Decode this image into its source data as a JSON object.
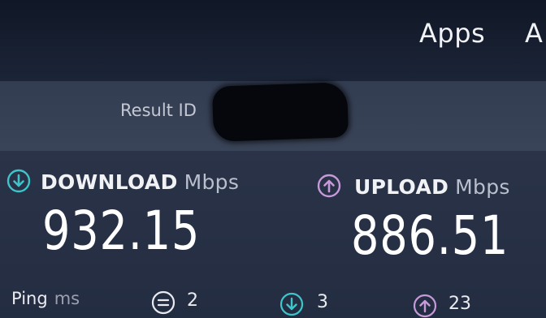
{
  "nav": {
    "apps_label": "Apps",
    "next_label": "A"
  },
  "result": {
    "label": "Result ID"
  },
  "download": {
    "label": "DOWNLOAD",
    "unit": "Mbps",
    "value": "932.15",
    "icon": "arrow-down-circle-icon",
    "color": "#3ec5c9"
  },
  "upload": {
    "label": "UPLOAD",
    "unit": "Mbps",
    "value": "886.51",
    "icon": "arrow-up-circle-icon",
    "color": "#c69ad9"
  },
  "ping": {
    "label": "Ping",
    "unit": "ms",
    "idle_value": "2",
    "download_value": "3",
    "upload_value": "23"
  }
}
